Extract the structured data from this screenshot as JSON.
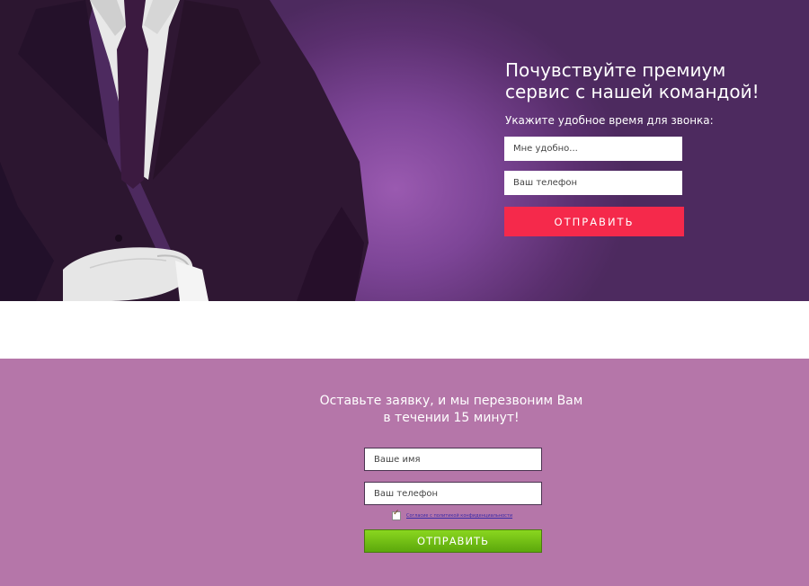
{
  "hero": {
    "title": "Почувствуйте премиум сервис с нашей командой!",
    "subtitle": "Укажите удобное время для звонка:",
    "time_placeholder": "Мне удобно...",
    "phone_placeholder": "Ваш телефон",
    "submit_label": "ОТПРАВИТЬ"
  },
  "callback_form": {
    "heading_line1": "Оставьте заявку, и мы перезвоним Вам",
    "heading_line2": "в течении 15 минут!",
    "name_placeholder": "Ваше имя",
    "phone_placeholder": "Ваш телефон",
    "consent_text": "Согласие с политикой конфиденциальности",
    "consent_checked": true,
    "submit_label": "ОТПРАВИТЬ"
  },
  "colors": {
    "hero_bg": "#5a2f6e",
    "hero_button": "#f5294b",
    "form_bg": "#b576a9",
    "form_button": "#6bbf12"
  }
}
